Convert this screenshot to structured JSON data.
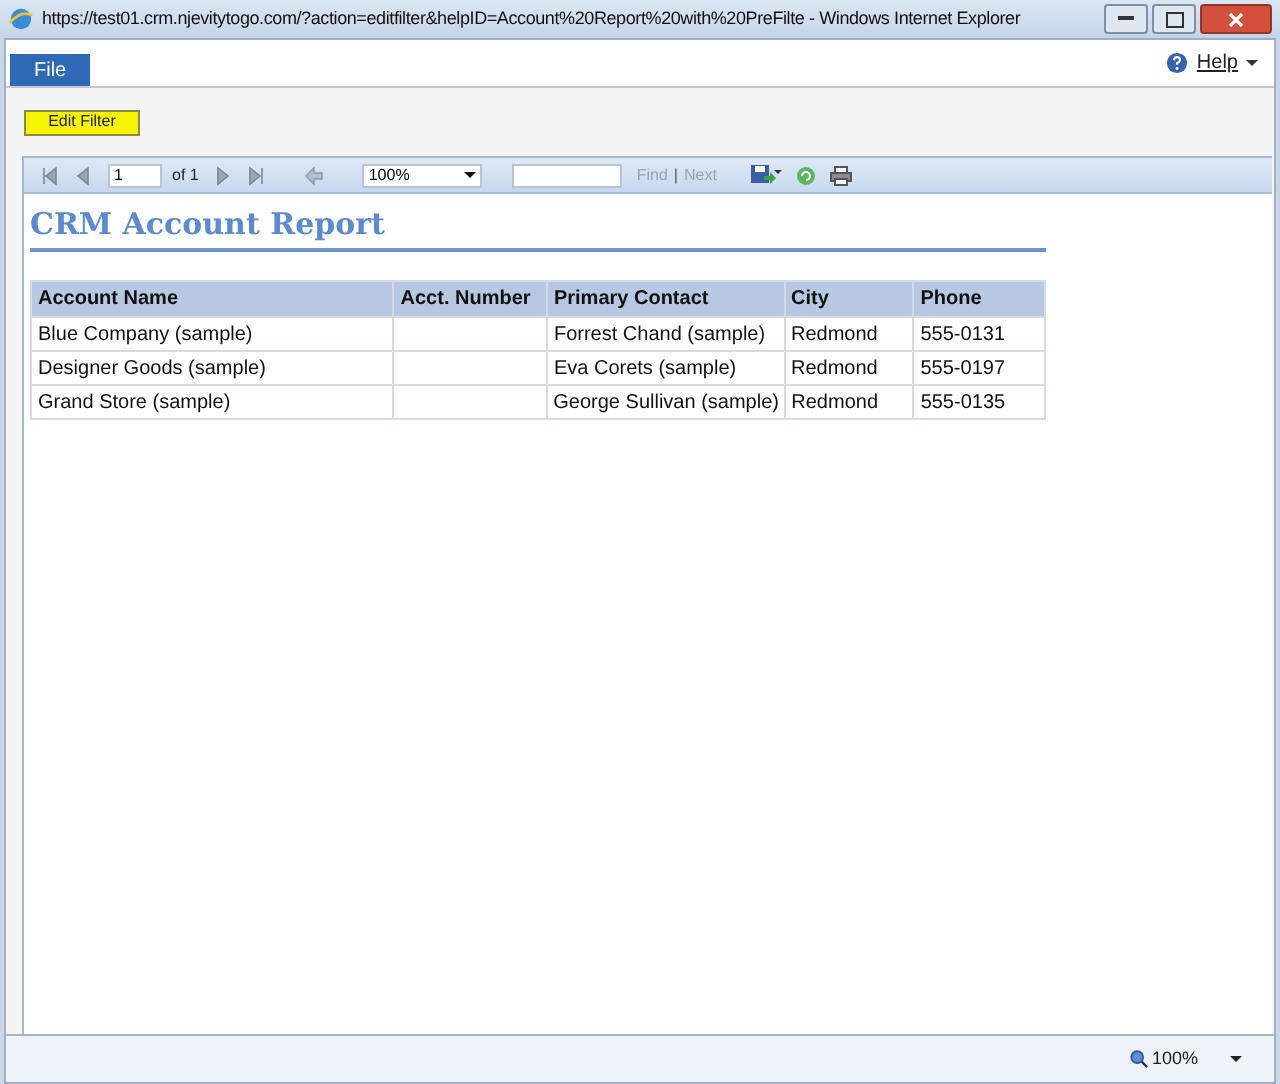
{
  "window": {
    "title": "https://test01.crm.njevitytogo.com/?action=editfilter&helpID=Account%20Report%20with%20PreFilte - Windows Internet Explorer"
  },
  "menu": {
    "file_tab": "File",
    "help": "Help"
  },
  "edit_filter_button": "Edit Filter",
  "report_toolbar": {
    "page": "1",
    "page_of": "of 1",
    "zoom": "100%",
    "find": "Find",
    "separator": "|",
    "next": "Next",
    "find_disabled": true
  },
  "report": {
    "title": "CRM Account Report",
    "table": {
      "columns": [
        "Account Name",
        "Acct. Number",
        "Primary Contact",
        "City",
        "Phone"
      ],
      "rows": [
        [
          "Blue Company (sample)",
          "",
          "Forrest Chand (sample)",
          "Redmond",
          "555-0131"
        ],
        [
          "Designer Goods (sample)",
          "",
          "Eva Corets (sample)",
          "Redmond",
          "555-0197"
        ],
        [
          "Grand Store (sample)",
          "",
          "George Sullivan (sample)",
          "Redmond",
          "555-0135"
        ]
      ]
    }
  },
  "status_bar": {
    "zoom": "100%"
  }
}
